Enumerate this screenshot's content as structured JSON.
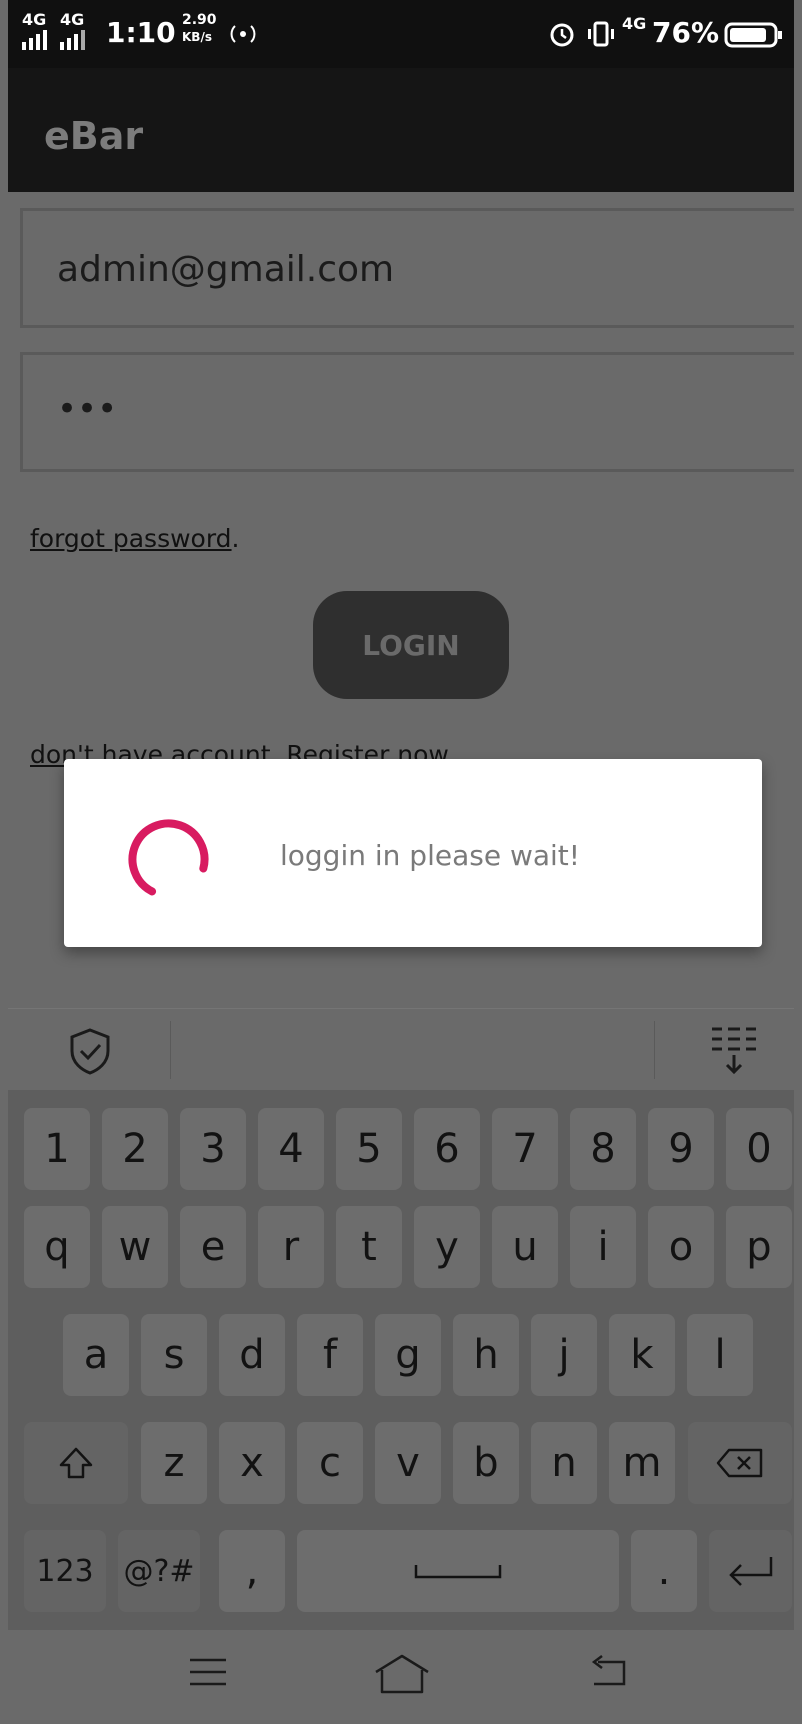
{
  "status_bar": {
    "network1": "4G",
    "network2": "4G",
    "time": "1:10",
    "speed_value": "2.90",
    "speed_unit": "KB/s",
    "network3": "4G",
    "battery": "76%"
  },
  "app_bar": {
    "title": "eBar"
  },
  "form": {
    "email_value": "admin@gmail.com",
    "password_value": "•••",
    "forgot_link": "forgot password",
    "forgot_suffix": ".",
    "login_label": "LOGIN",
    "register_link": "don",
    "register_rest": "'t have account. Register now."
  },
  "dialog": {
    "message": "loggin in please wait!"
  },
  "keyboard": {
    "number_row": [
      "1",
      "2",
      "3",
      "4",
      "5",
      "6",
      "7",
      "8",
      "9",
      "0"
    ],
    "row1": [
      "q",
      "w",
      "e",
      "r",
      "t",
      "y",
      "u",
      "i",
      "o",
      "p"
    ],
    "row2": [
      "a",
      "s",
      "d",
      "f",
      "g",
      "h",
      "j",
      "k",
      "l"
    ],
    "row3": [
      "z",
      "x",
      "c",
      "v",
      "b",
      "n",
      "m"
    ],
    "bottom": {
      "numbers": "123",
      "symbols": "@?#",
      "comma": ",",
      "period": "."
    }
  },
  "colors": {
    "spinner": "#d81b60",
    "app_bar": "#151515",
    "overlay_bg": "#6a6a6a"
  }
}
